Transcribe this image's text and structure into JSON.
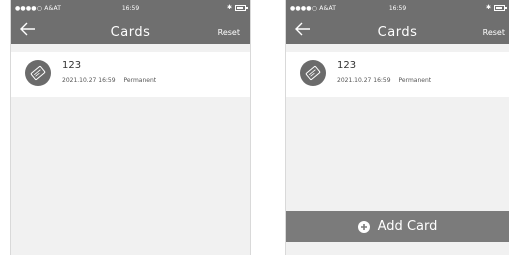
{
  "status_bar": {
    "carrier": "●●●●○ A&AT",
    "time": "16:59"
  },
  "header": {
    "title": "Cards",
    "reset_label": "Reset"
  },
  "cards": [
    {
      "name": "123",
      "date": "2021.10.27 16:59",
      "validity": "Permanent"
    }
  ],
  "add_card_label": "Add Card",
  "colors": {
    "header": "#6f6f6f",
    "background": "#f1f1f1",
    "button": "#7b7b7b"
  },
  "icons": [
    "back-arrow-icon",
    "wifi-icon",
    "bluetooth-icon",
    "battery-icon",
    "card-icon",
    "plus-circle-icon"
  ]
}
